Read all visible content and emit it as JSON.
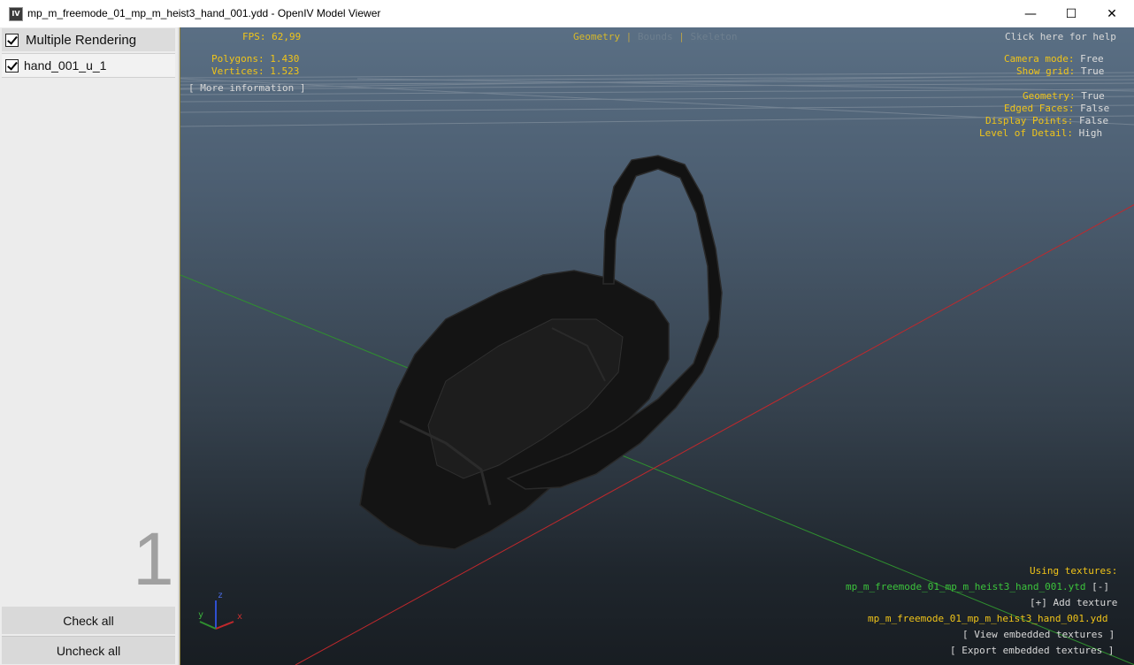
{
  "window": {
    "title": "mp_m_freemode_01_mp_m_heist3_hand_001.ydd - OpenIV Model Viewer",
    "app_icon_text": "IV",
    "minimize_glyph": "—",
    "maximize_glyph": "☐",
    "close_glyph": "✕"
  },
  "left_panel": {
    "multiple_rendering_label": "Multiple Rendering",
    "items": [
      {
        "label": "hand_001_u_1",
        "checked": true
      }
    ],
    "count": "1",
    "check_all_label": "Check all",
    "uncheck_all_label": "Uncheck all"
  },
  "viewport": {
    "fps_label": "FPS:",
    "fps_value": "62,99",
    "polygons_label": "Polygons:",
    "polygons_value": "1.430",
    "vertices_label": "Vertices:",
    "vertices_value": "1.523",
    "more_info": "[ More information ]",
    "tabs": {
      "geometry": "Geometry",
      "bounds": "Bounds",
      "skeleton": "Skeleton",
      "separator": "|"
    },
    "help_link": "Click here for help",
    "settings": [
      {
        "label": "Camera mode:",
        "value": "Free"
      },
      {
        "label": "Show grid:",
        "value": "True"
      }
    ],
    "display": [
      {
        "label": "Geometry:",
        "value": "True"
      },
      {
        "label": "Edged Faces:",
        "value": "False"
      },
      {
        "label": "Display Points:",
        "value": "False"
      },
      {
        "label": "Level of Detail:",
        "value": "High"
      }
    ],
    "textures": {
      "heading": "Using textures:",
      "ytd_file": "mp_m_freemode_01_mp_m_heist3_hand_001.ytd",
      "ytd_toggle": "[-]",
      "add_texture": "[+] Add texture",
      "ydd_file": "mp_m_freemode_01_mp_m_heist3_hand_001.ydd",
      "view_embedded": "[ View embedded textures ]",
      "export_embedded": "[ Export embedded textures ]"
    },
    "gizmo": {
      "z": "z",
      "y": "y",
      "x": "x"
    }
  },
  "colors": {
    "hud_yellow": "#f0c419",
    "hud_white": "#d8d8d8",
    "hud_green": "#3cc43c",
    "axis_red": "#c0282c",
    "axis_green": "#2f8f2f",
    "axis_blue": "#2f4fd0"
  }
}
